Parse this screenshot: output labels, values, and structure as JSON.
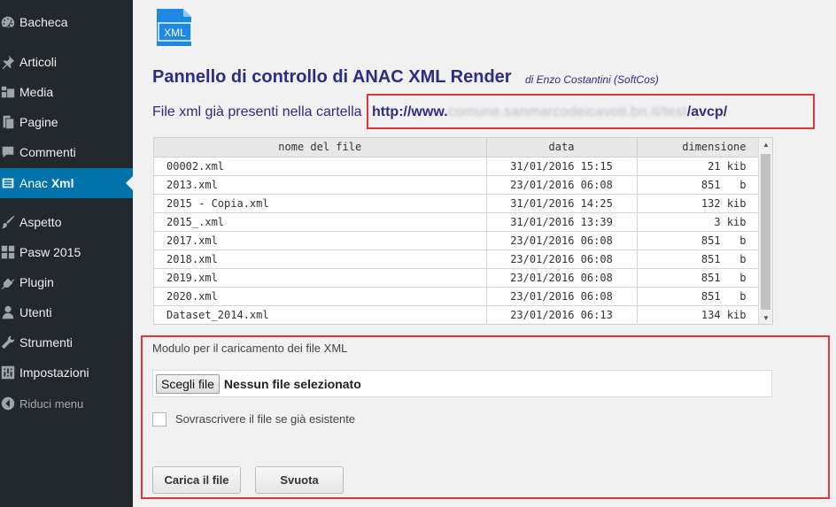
{
  "sidebar": {
    "items": [
      {
        "label": "Bacheca",
        "icon": "dashboard-icon"
      },
      {
        "label": "Articoli",
        "icon": "pin-icon"
      },
      {
        "label": "Media",
        "icon": "media-icon"
      },
      {
        "label": "Pagine",
        "icon": "pages-icon"
      },
      {
        "label": "Commenti",
        "icon": "comments-icon"
      },
      {
        "label_pre": "Anac ",
        "label_bold": "Xml",
        "icon": "list-icon"
      },
      {
        "label": "Aspetto",
        "icon": "brush-icon"
      },
      {
        "label": "Pasw 2015",
        "icon": "grid-icon"
      },
      {
        "label": "Plugin",
        "icon": "plugin-icon"
      },
      {
        "label": "Utenti",
        "icon": "users-icon"
      },
      {
        "label": "Strumenti",
        "icon": "wrench-icon"
      },
      {
        "label": "Impostazioni",
        "icon": "settings-icon"
      },
      {
        "label": "Riduci menu",
        "icon": "collapse-icon"
      }
    ]
  },
  "main": {
    "logo_text": "XML",
    "title": "Pannello di controllo di ANAC XML Render",
    "author": "di Enzo Costantini (SoftCos)",
    "folder_label": "File xml già presenti nella cartella",
    "url_start": "http://www.",
    "url_blurred": "comune.sanmarcodeicavoti.bn.it/test",
    "url_end": "/avcp/"
  },
  "table": {
    "headers": [
      "nome del file",
      "data",
      "dimensione"
    ],
    "rows": [
      [
        "00002.xml",
        "31/01/2016 15:15",
        "21 kib"
      ],
      [
        "2013.xml",
        "23/01/2016 06:08",
        "851   b"
      ],
      [
        "2015 - Copia.xml",
        "31/01/2016 14:25",
        "132 kib"
      ],
      [
        "2015_.xml",
        "31/01/2016 13:39",
        "3 kib"
      ],
      [
        "2017.xml",
        "23/01/2016 06:08",
        "851   b"
      ],
      [
        "2018.xml",
        "23/01/2016 06:08",
        "851   b"
      ],
      [
        "2019.xml",
        "23/01/2016 06:08",
        "851   b"
      ],
      [
        "2020.xml",
        "23/01/2016 06:08",
        "851   b"
      ],
      [
        "Dataset_2014.xml",
        "23/01/2016 06:13",
        "134 kib"
      ]
    ]
  },
  "upload": {
    "title": "Modulo per il caricamento dei file XML",
    "choose_label": "Scegli file",
    "no_file": "Nessun file selezionato",
    "overwrite_label": "Sovrascrivere il file se già esistente",
    "upload_button": "Carica il file",
    "empty_button": "Svuota"
  },
  "colors": {
    "sidebar_bg": "#23282d",
    "active_bg": "#0073aa",
    "title_color": "#2d2d82",
    "highlight_border": "#e0383a"
  }
}
